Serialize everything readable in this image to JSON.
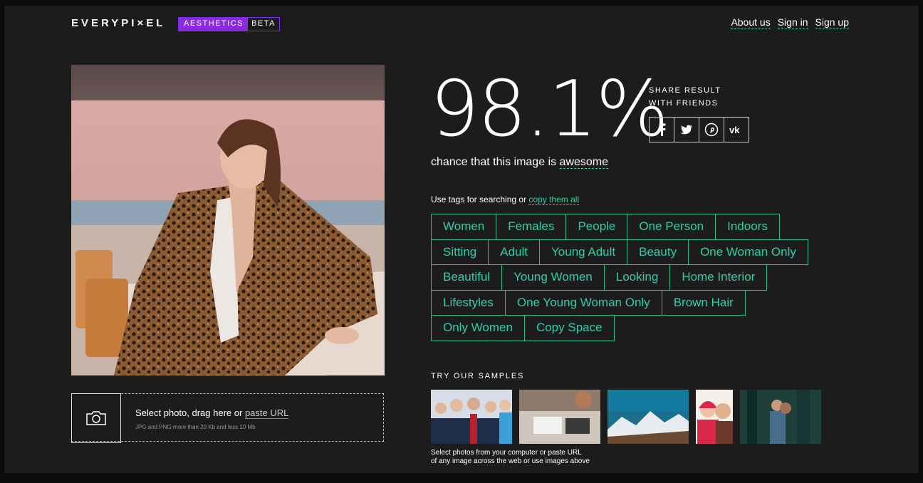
{
  "header": {
    "logo": "EVERYPI×EL",
    "badge_main": "AESTHETICS",
    "badge_sub": "BETA",
    "nav": [
      "About us",
      "Sign in",
      "Sign up"
    ]
  },
  "upload": {
    "prompt": "Select photo, drag here or ",
    "url_link": "paste URL",
    "hint": "JPG and PNG more than 20 Kb and less 10 Mb"
  },
  "result": {
    "score": "98.1%",
    "share_line1": "SHARE RESULT",
    "share_line2": "WITH FRIENDS",
    "social": [
      {
        "icon": "facebook-icon",
        "glyph": "f"
      },
      {
        "icon": "twitter-icon",
        "glyph": "t"
      },
      {
        "icon": "pinterest-icon",
        "glyph": "p"
      },
      {
        "icon": "vk-icon",
        "glyph": "vk"
      }
    ],
    "chance_text": "chance that this image is ",
    "chance_word": "awesome"
  },
  "tags_section": {
    "intro": "Use tags for searching or ",
    "copy_link": "copy them all",
    "rows": [
      [
        "Women",
        "Females",
        "People",
        "One Person",
        "Indoors"
      ],
      [
        "Sitting",
        "Adult",
        "Young Adult",
        "Beauty",
        "One Woman Only"
      ],
      [
        "Beautiful",
        "Young Women",
        "Looking",
        "Home Interior"
      ],
      [
        "Lifestyles",
        "One Young Woman Only",
        "Brown Hair"
      ],
      [
        "Only Women",
        "Copy Space"
      ]
    ]
  },
  "samples": {
    "title": "TRY OUR SAMPLES",
    "note_line1": "Select photos from your computer or paste URL",
    "note_line2": "of any image across the web or use images above",
    "items": [
      "business-team-photo",
      "office-desk-photo",
      "mountain-landscape-photo",
      "couple-photo",
      "forest-couple-photo"
    ]
  },
  "colors": {
    "accent": "#2dcfa8",
    "badge": "#8a2be2",
    "background": "#1c1c1c"
  }
}
